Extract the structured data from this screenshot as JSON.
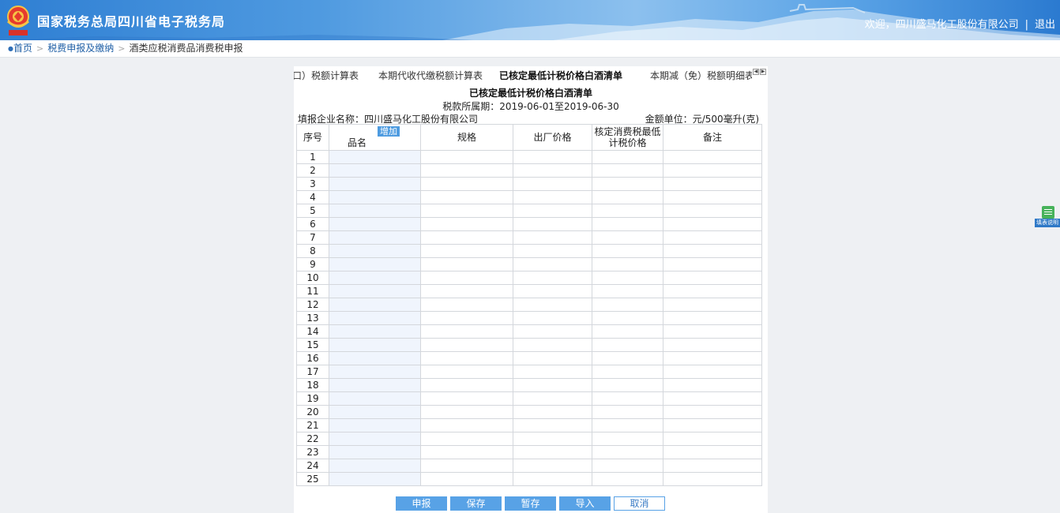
{
  "header": {
    "site_title": "国家税务总局四川省电子税务局",
    "welcome": "欢迎，四川盛马化工股份有限公司",
    "divider": "|",
    "logout": "退出"
  },
  "breadcrumb": {
    "home": "首页",
    "sep": ">",
    "section": "税费申报及缴纳",
    "current": "酒类应税消费品消费税申报"
  },
  "tabs": [
    {
      "label": "口）税额计算表",
      "active": false
    },
    {
      "label": "本期代收代缴税额计算表",
      "active": false
    },
    {
      "label": "已核定最低计税价格白酒清单",
      "active": true
    },
    {
      "label": "本期减（免）税额明细表",
      "active": false
    }
  ],
  "form": {
    "title": "已核定最低计税价格白酒清单",
    "period_label": "税款所属期：",
    "period_value": "2019-06-01至2019-06-30",
    "company_label": "填报企业名称：",
    "company_value": "四川盛马化工股份有限公司",
    "unit_label": "金额单位：",
    "unit_value": "元/500毫升(克)"
  },
  "table": {
    "add_label": "增加",
    "columns": [
      {
        "line1": "序号",
        "line2": ""
      },
      {
        "line1": "品名",
        "line2": ""
      },
      {
        "line1": "规格",
        "line2": ""
      },
      {
        "line1": "出厂价格",
        "line2": ""
      },
      {
        "line1": "核定消费税最低",
        "line2": "计税价格"
      },
      {
        "line1": "备注",
        "line2": ""
      }
    ],
    "rows": [
      1,
      2,
      3,
      4,
      5,
      6,
      7,
      8,
      9,
      10,
      11,
      12,
      13,
      14,
      15,
      16,
      17,
      18,
      19,
      20,
      21,
      22,
      23,
      24,
      25
    ]
  },
  "buttons": {
    "submit": "申报",
    "save": "保存",
    "draft": "暂存",
    "import": "导入",
    "cancel": "取消"
  },
  "side_help": {
    "label": "填表说明",
    "icon": "document-icon"
  },
  "colors": {
    "header_blue": "#3a86d6",
    "button_blue": "#58a2e6",
    "name_column_fill": "#f0f5fd"
  }
}
